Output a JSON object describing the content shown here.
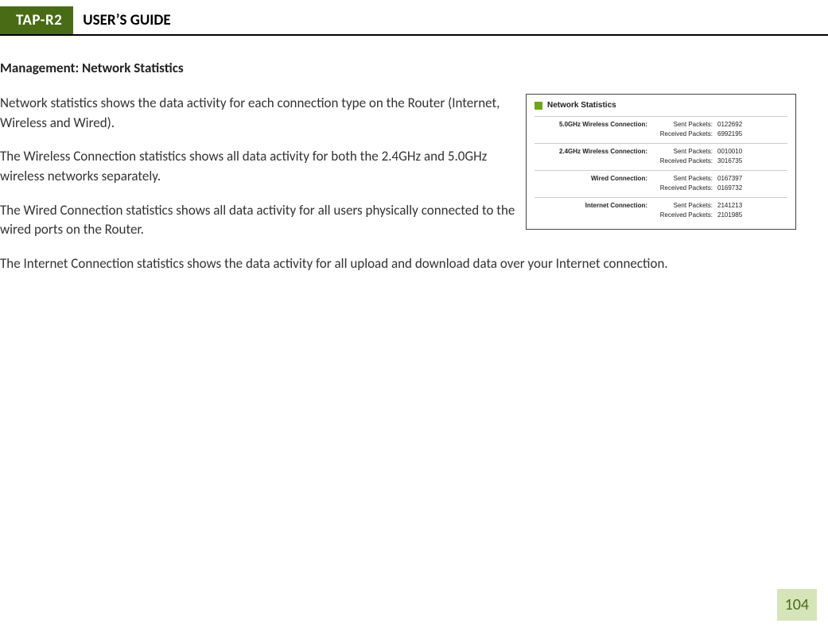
{
  "header": {
    "model": "TAP-R2",
    "title": "USER’S GUIDE"
  },
  "section": {
    "heading": "Management: Network Statistics",
    "p1": "Network statistics shows the data activity for each connection type on the Router (Internet, Wireless and Wired).",
    "p2": "The Wireless Connection statistics shows all data activity for both the 2.4GHz and 5.0GHz wireless networks separately.",
    "p3": "The Wired Connection statistics shows all data activity for all users physically connected to the wired ports on the Router.",
    "p4": "The Internet Connection statistics shows the data activity for all upload and download data over your Internet connection."
  },
  "figure": {
    "title": "Network Statistics",
    "rows": [
      {
        "conn": "5.0GHz Wireless Connection:",
        "sent_label": "Sent Packets:",
        "sent": "0122692",
        "recv_label": "Received Packets:",
        "recv": "6992195"
      },
      {
        "conn": "2.4GHz Wireless Connection:",
        "sent_label": "Sent Packets:",
        "sent": "0010010",
        "recv_label": "Received Packets:",
        "recv": "3016735"
      },
      {
        "conn": "Wired Connection:",
        "sent_label": "Sent Packets:",
        "sent": "0167397",
        "recv_label": "Received Packets:",
        "recv": "0169732"
      },
      {
        "conn": "Internet Connection:",
        "sent_label": "Sent Packets:",
        "sent": "2141213",
        "recv_label": "Received Packets:",
        "recv": "2101985"
      }
    ]
  },
  "page_number": "104"
}
